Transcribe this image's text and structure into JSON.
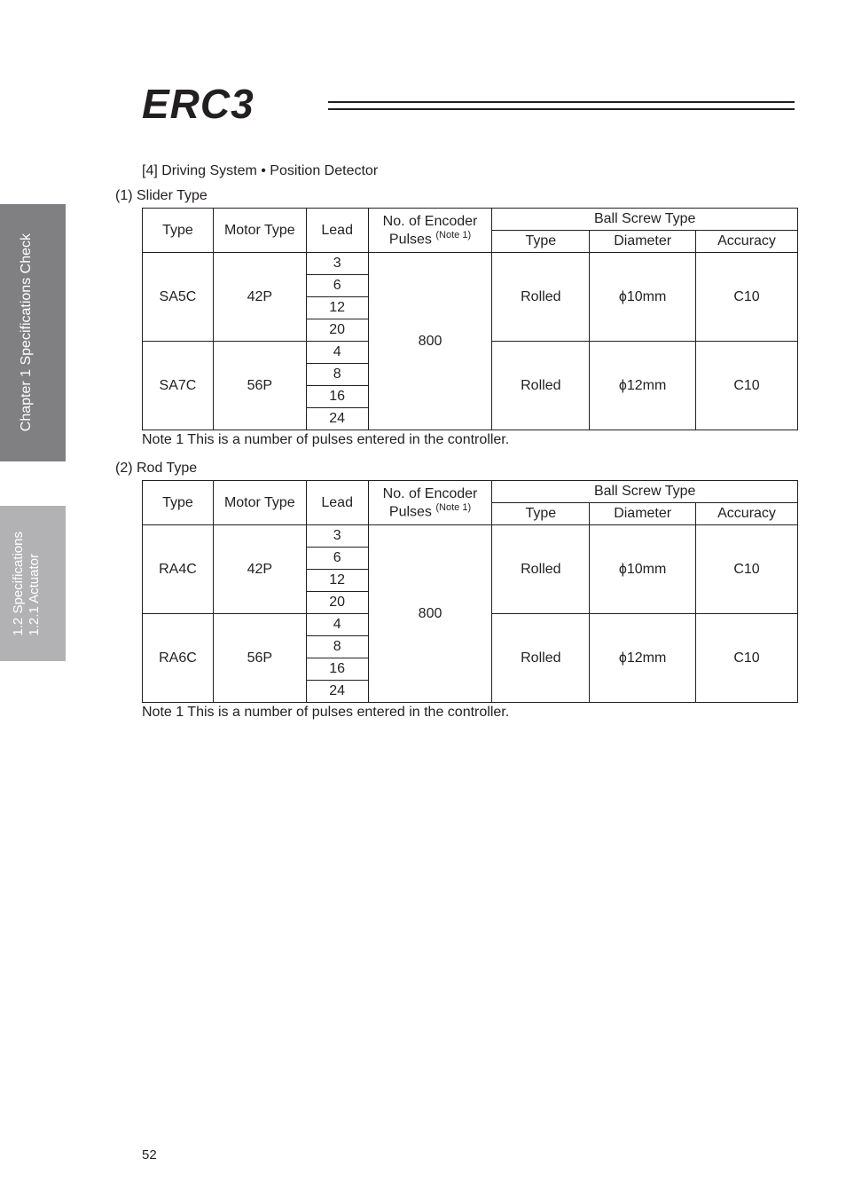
{
  "logo": {
    "text": "ERC3"
  },
  "side_tabs": [
    {
      "label": "Chapter 1 Specifications Check"
    },
    {
      "label_line1": "1.2 Specifications",
      "label_line2": "1.2.1 Actuator"
    }
  ],
  "heading4": "[4] Driving System • Position Detector",
  "sections": [
    {
      "title": "(1) Slider Type",
      "note": "Note 1  This is a number of pulses entered in the controller."
    },
    {
      "title": "(2) Rod Type",
      "note": "Note 1  This is a number of pulses entered in the controller."
    }
  ],
  "table_headers": {
    "type": "Type",
    "motor_type": "Motor Type",
    "lead": "Lead",
    "encoder_line1": "No. of Encoder",
    "encoder_line2_a": "Pulses ",
    "encoder_line2_b": "(Note 1)",
    "ball_screw": "Ball Screw Type",
    "bs_type": "Type",
    "bs_diameter": "Diameter",
    "bs_accuracy": "Accuracy"
  },
  "chart_data": [
    {
      "type": "table",
      "title": "(1) Slider Type",
      "columns": [
        "Type",
        "Motor Type",
        "Lead",
        "No. of Encoder Pulses (Note 1)",
        "Ball Screw Type – Type",
        "Ball Screw Type – Diameter",
        "Ball Screw Type – Accuracy"
      ],
      "rows": [
        {
          "Type": "SA5C",
          "Motor Type": "42P",
          "Leads": [
            3,
            6,
            12,
            20
          ],
          "Encoder Pulses": 800,
          "BS Type": "Rolled",
          "Diameter": "ϕ10mm",
          "Accuracy": "C10"
        },
        {
          "Type": "SA7C",
          "Motor Type": "56P",
          "Leads": [
            4,
            8,
            16,
            24
          ],
          "Encoder Pulses": 800,
          "BS Type": "Rolled",
          "Diameter": "ϕ12mm",
          "Accuracy": "C10"
        }
      ]
    },
    {
      "type": "table",
      "title": "(2) Rod Type",
      "columns": [
        "Type",
        "Motor Type",
        "Lead",
        "No. of Encoder Pulses (Note 1)",
        "Ball Screw Type – Type",
        "Ball Screw Type – Diameter",
        "Ball Screw Type – Accuracy"
      ],
      "rows": [
        {
          "Type": "RA4C",
          "Motor Type": "42P",
          "Leads": [
            3,
            6,
            12,
            20
          ],
          "Encoder Pulses": 800,
          "BS Type": "Rolled",
          "Diameter": "ϕ10mm",
          "Accuracy": "C10"
        },
        {
          "Type": "RA6C",
          "Motor Type": "56P",
          "Leads": [
            4,
            8,
            16,
            24
          ],
          "Encoder Pulses": 800,
          "BS Type": "Rolled",
          "Diameter": "ϕ12mm",
          "Accuracy": "C10"
        }
      ]
    }
  ],
  "table1": {
    "r1_type": "SA5C",
    "r1_motor": "42P",
    "r1_leads": [
      "3",
      "6",
      "12",
      "20"
    ],
    "r1_bs_type": "Rolled",
    "r1_dia": "ϕ10mm",
    "r1_acc": "C10",
    "r2_type": "SA7C",
    "r2_motor": "56P",
    "r2_leads": [
      "4",
      "8",
      "16",
      "24"
    ],
    "r2_bs_type": "Rolled",
    "r2_dia": "ϕ12mm",
    "r2_acc": "C10",
    "pulses": "800"
  },
  "table2": {
    "r1_type": "RA4C",
    "r1_motor": "42P",
    "r1_leads": [
      "3",
      "6",
      "12",
      "20"
    ],
    "r1_bs_type": "Rolled",
    "r1_dia": "ϕ10mm",
    "r1_acc": "C10",
    "r2_type": "RA6C",
    "r2_motor": "56P",
    "r2_leads": [
      "4",
      "8",
      "16",
      "24"
    ],
    "r2_bs_type": "Rolled",
    "r2_dia": "ϕ12mm",
    "r2_acc": "C10",
    "pulses": "800"
  },
  "page_number": "52"
}
